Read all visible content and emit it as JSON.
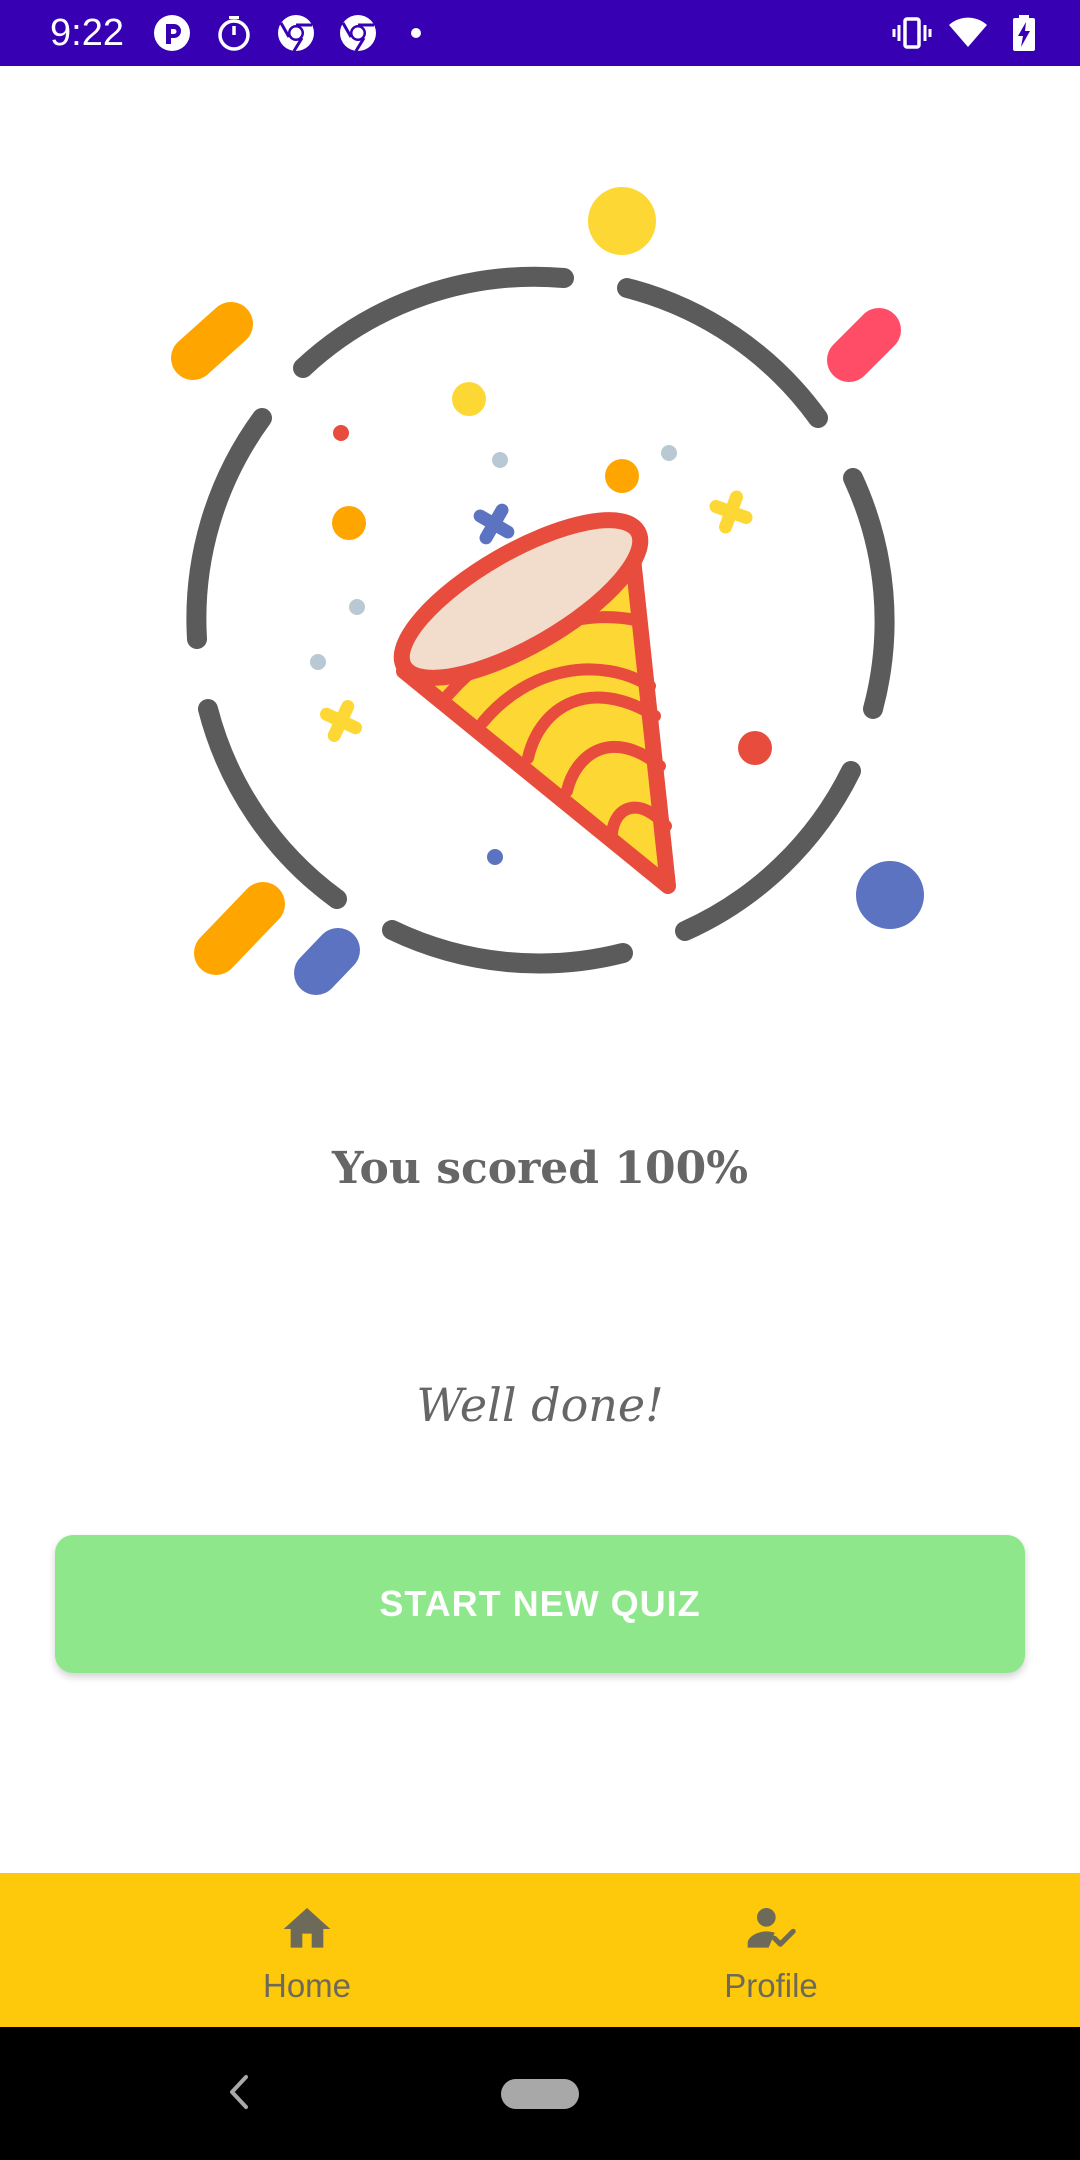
{
  "status_bar": {
    "time": "9:22",
    "left_icons": [
      "app-notification-icon",
      "timer-icon",
      "chrome-icon",
      "chrome-icon",
      "dot-icon"
    ],
    "right_icons": [
      "vibrate-icon",
      "wifi-icon",
      "battery-charging-icon"
    ],
    "background_color": "#3700b3"
  },
  "illustration": {
    "name": "party-popper-celebration",
    "colors": [
      "#5b5b5b",
      "#e74c3c",
      "#fdd835",
      "#ffa500",
      "#5c73c1",
      "#ff4d67",
      "#b8c9d3",
      "#f2dccb"
    ]
  },
  "result": {
    "score_text": "You scored 100%",
    "message": "Well done!"
  },
  "actions": {
    "start_new_quiz": "START NEW QUIZ",
    "button_color": "#8ee78b"
  },
  "bottom_nav": {
    "background_color": "#fdc90a",
    "items": [
      {
        "label": "Home",
        "icon": "home-icon"
      },
      {
        "label": "Profile",
        "icon": "profile-check-icon"
      }
    ]
  },
  "system_nav": {
    "back_icon": "back-chevron-icon",
    "home_icon": "home-pill-icon"
  }
}
